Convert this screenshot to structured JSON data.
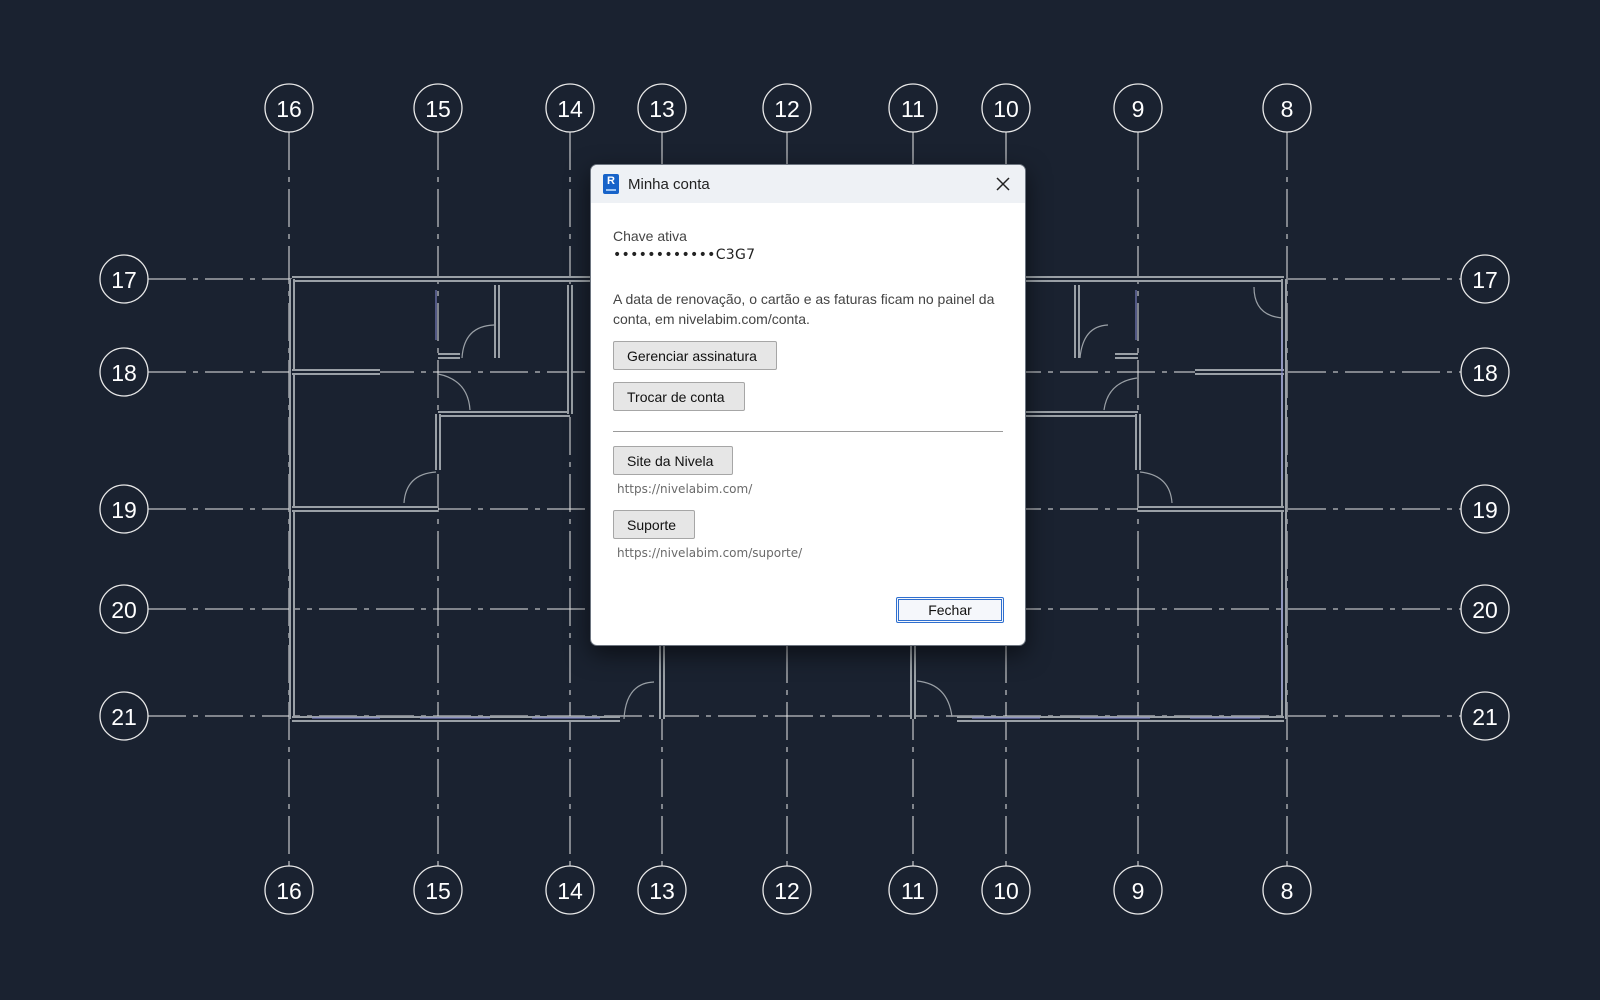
{
  "background": {
    "bubbles_top": [
      "16",
      "15",
      "14",
      "13",
      "12",
      "11",
      "10",
      "9",
      "8"
    ],
    "bubbles_bottom": [
      "16",
      "15",
      "14",
      "13",
      "12",
      "11",
      "10",
      "9",
      "8"
    ],
    "bubbles_left": [
      "17",
      "18",
      "19",
      "20",
      "21"
    ],
    "bubbles_right": [
      "17",
      "18",
      "19",
      "20",
      "21"
    ],
    "colors": {
      "canvas": "#1a2230",
      "grid_line": "#e8e8e8",
      "wall": "#9aa0a6"
    }
  },
  "dialog": {
    "title": "Minha conta",
    "app_icon_letter": "R",
    "active_key_label": "Chave ativa",
    "active_key_value": "••••••••••••C3G7",
    "info_text": "A data de renovação, o cartão e as faturas ficam no painel da conta, em nivelabim.com/conta.",
    "manage_label": "Gerenciar assinatura",
    "switch_label": "Trocar de conta",
    "site_label": "Site da Nivela",
    "site_url": "https://nivelabim.com/",
    "support_label": "Suporte",
    "support_url": "https://nivelabim.com/suporte/",
    "close_label": "Fechar",
    "icons": {
      "close": "close-icon",
      "app": "revit-app-icon"
    }
  }
}
